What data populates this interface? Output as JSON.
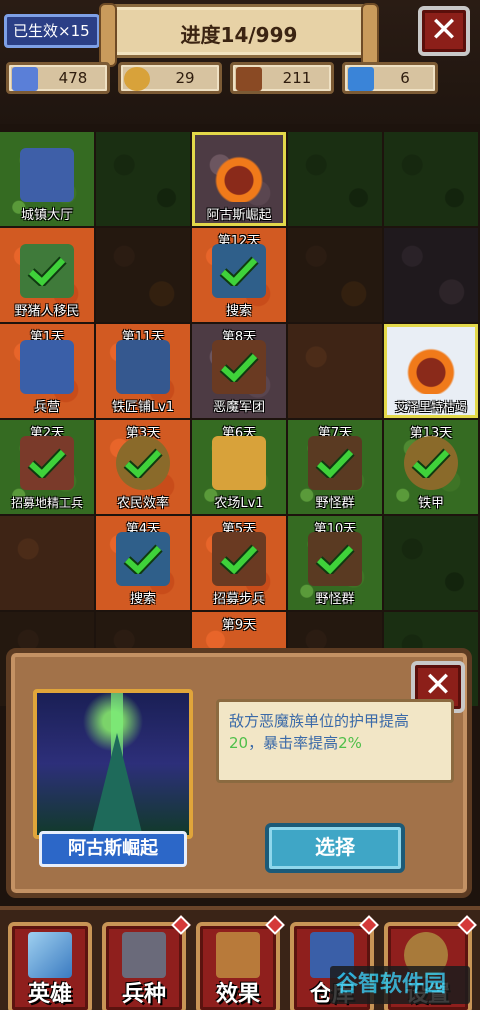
{
  "header": {
    "alive_badge": "已生效×15",
    "progress": "进度14/999",
    "close_glyph": "✕"
  },
  "resources": [
    {
      "icon": "population-icon",
      "value": "478",
      "color": "#5a7fd8"
    },
    {
      "icon": "gold-coins-icon",
      "value": "29",
      "color": "#d8a23a"
    },
    {
      "icon": "wood-logs-icon",
      "value": "211",
      "color": "#8a4a24"
    },
    {
      "icon": "magic-staff-icon",
      "value": "6",
      "color": "#3a84d8"
    }
  ],
  "tiles": [
    {
      "label": "城镇大厅",
      "day": "",
      "check": false
    },
    {
      "label": "",
      "day": "",
      "check": false
    },
    {
      "label": "阿古斯崛起",
      "day": "",
      "check": false
    },
    {
      "label": "",
      "day": "",
      "check": false
    },
    {
      "label": "",
      "day": "",
      "check": false
    },
    {
      "label": "野猪人移民",
      "day": "",
      "check": true
    },
    {
      "label": "",
      "day": "",
      "check": false
    },
    {
      "label": "搜索",
      "day": "第12天",
      "check": true
    },
    {
      "label": "",
      "day": "",
      "check": false
    },
    {
      "label": "",
      "day": "",
      "check": false
    },
    {
      "label": "兵营",
      "day": "第1天",
      "check": false
    },
    {
      "label": "铁匠铺Lv1",
      "day": "第11天",
      "check": false
    },
    {
      "label": "恶魔军团",
      "day": "第8天",
      "check": true
    },
    {
      "label": "",
      "day": "",
      "check": false
    },
    {
      "label": "艾泽里特枯竭",
      "day": "",
      "check": false
    },
    {
      "label": "招募地精工兵",
      "day": "第2天",
      "check": true
    },
    {
      "label": "农民效率",
      "day": "第3天",
      "check": true
    },
    {
      "label": "农场Lv1",
      "day": "第6天",
      "check": false
    },
    {
      "label": "野怪群",
      "day": "第7天",
      "check": true
    },
    {
      "label": "铁甲",
      "day": "第13天",
      "check": true
    },
    {
      "label": "",
      "day": "",
      "check": false
    },
    {
      "label": "搜索",
      "day": "第4天",
      "check": true
    },
    {
      "label": "招募步兵",
      "day": "第5天",
      "check": true
    },
    {
      "label": "野怪群",
      "day": "第10天",
      "check": true
    },
    {
      "label": "",
      "day": "",
      "check": false
    },
    {
      "label": "",
      "day": "",
      "check": false
    },
    {
      "label": "",
      "day": "",
      "check": false
    },
    {
      "label": "",
      "day": "第9天",
      "check": false
    },
    {
      "label": "",
      "day": "",
      "check": false
    },
    {
      "label": "",
      "day": "",
      "check": false
    }
  ],
  "panel": {
    "name": "阿古斯崛起",
    "desc_part1": "敌方恶魔族单位的护甲提高",
    "desc_val1": "20",
    "desc_part2": "，暴击率提高",
    "desc_val2": "2%",
    "select_label": "选择",
    "close_glyph": "✕"
  },
  "nav": [
    {
      "label": "英雄",
      "icon": "sword-icon",
      "dot": false
    },
    {
      "label": "兵种",
      "icon": "knight-helmet-icon",
      "dot": true
    },
    {
      "label": "效果",
      "icon": "spellbook-icon",
      "dot": true
    },
    {
      "label": "仓库",
      "icon": "treasure-chest-icon",
      "dot": true
    },
    {
      "label": "设置",
      "icon": "gear-icon",
      "dot": true
    }
  ],
  "watermark": "谷智软件园"
}
